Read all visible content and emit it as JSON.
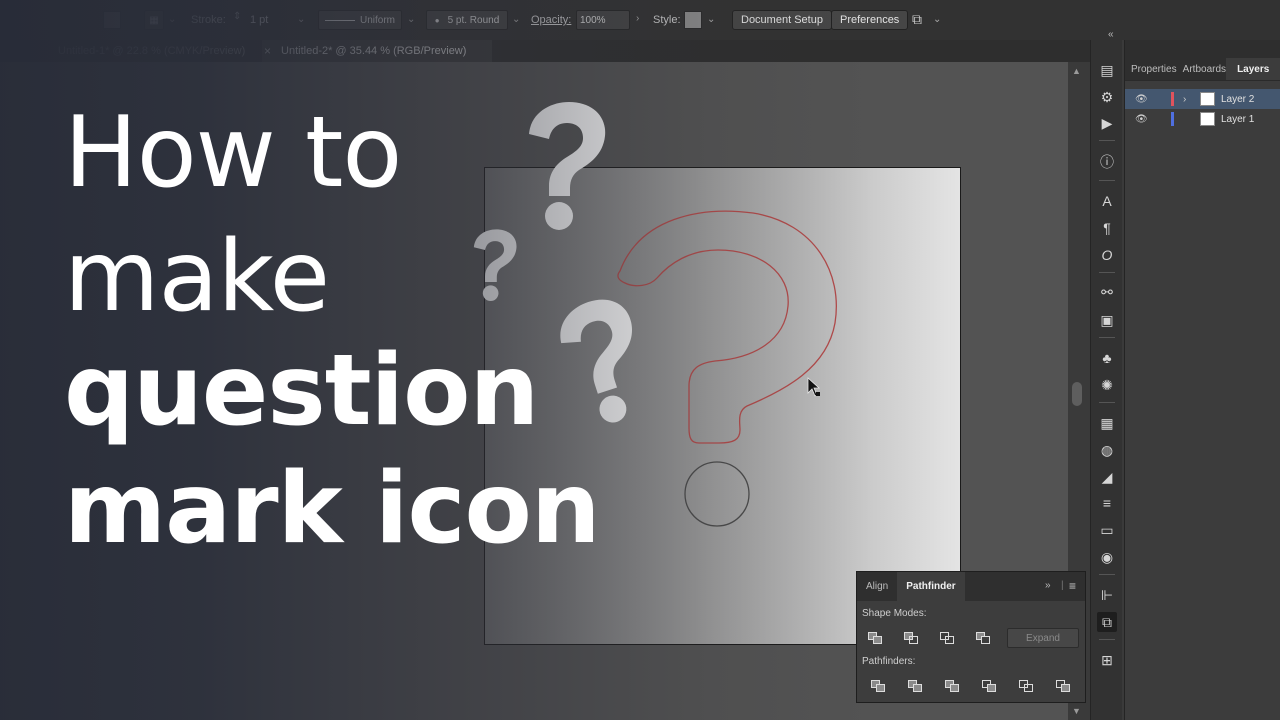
{
  "control_bar": {
    "stroke_label": "Stroke:",
    "stroke_value": "1 pt",
    "profile_label": "Uniform",
    "brush_label": "5 pt. Round",
    "opacity_label": "Opacity:",
    "opacity_value": "100%",
    "style_label": "Style:",
    "document_setup_label": "Document Setup",
    "preferences_label": "Preferences"
  },
  "doc_tabs": [
    {
      "label": "Untitled-1* @ 22.8 % (CMYK/Preview)"
    },
    {
      "label": "Untitled-2* @ 35.44 % (RGB/Preview)"
    }
  ],
  "headline": {
    "line1": "How to",
    "line2": "make",
    "line3": "question",
    "line4": "mark icon"
  },
  "layers_panel": {
    "tabs": [
      "Properties",
      "Artboards",
      "Layers"
    ],
    "layers": [
      {
        "name": "Layer 2",
        "color": "#e0535d"
      },
      {
        "name": "Layer 1",
        "color": "#4f6fe0"
      }
    ]
  },
  "pathfinder_panel": {
    "tabs": [
      "Align",
      "Pathfinder"
    ],
    "shape_modes_label": "Shape Modes:",
    "pathfinders_label": "Pathfinders:",
    "expand_label": "Expand"
  },
  "tool_icons": [
    "libraries-icon",
    "asset-export-icon",
    "actions-icon",
    "info-icon",
    "character-icon",
    "paragraph-icon",
    "opentype-icon",
    "links-icon",
    "artboards-icon",
    "symbols-icon",
    "brushes-icon",
    "swatches-icon",
    "color-guide-icon",
    "transparency-icon",
    "stroke-icon",
    "gradient-icon",
    "appearance-icon",
    "align-icon",
    "pathfinder-icon",
    "transform-icon"
  ],
  "colors": {
    "accent_selected": "#44576f",
    "question_outline": "#b24a4a"
  }
}
